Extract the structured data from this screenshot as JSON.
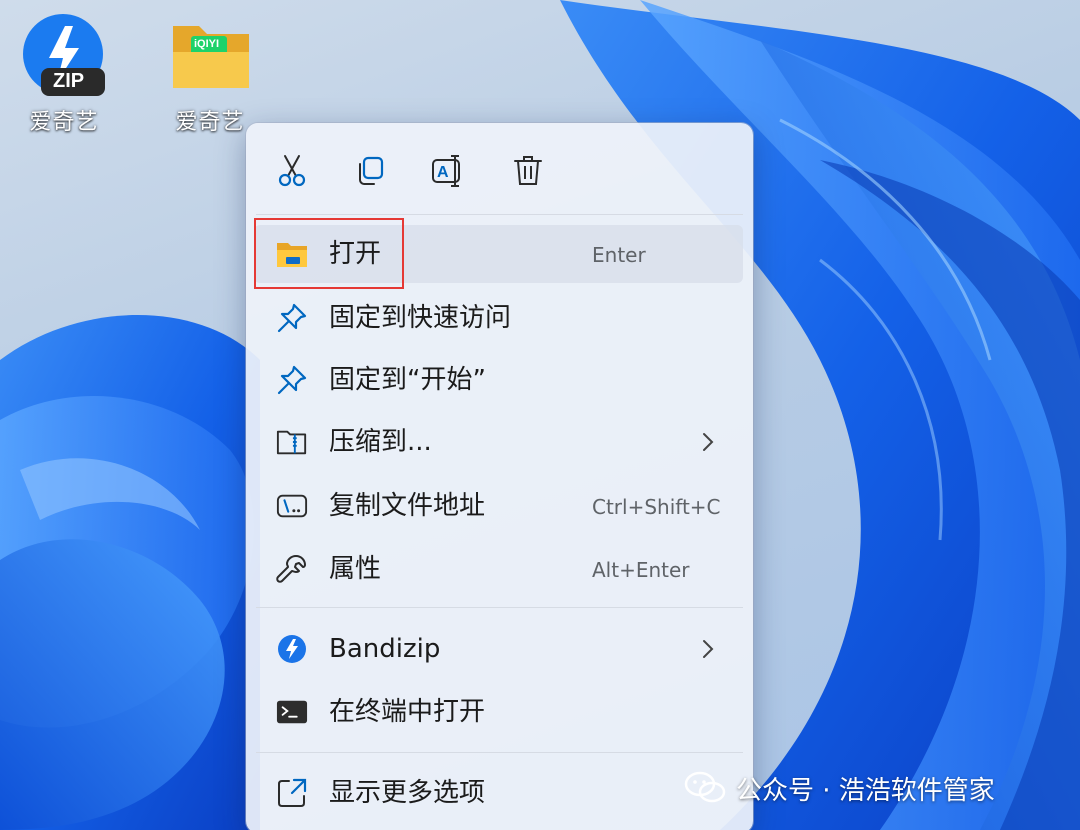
{
  "desktop": {
    "icons": [
      {
        "label": "爱奇艺",
        "icon": "bandizip-zip-icon",
        "badge_text": "ZIP"
      },
      {
        "label": "爱奇艺",
        "icon": "folder-icon",
        "badge_text": "iQIYI"
      }
    ]
  },
  "context_menu": {
    "toolbar": [
      {
        "action": "cut",
        "icon": "scissors-icon"
      },
      {
        "action": "copy",
        "icon": "copy-icon"
      },
      {
        "action": "rename",
        "icon": "rename-icon"
      },
      {
        "action": "delete",
        "icon": "trash-icon"
      }
    ],
    "items": [
      {
        "label": "打开",
        "shortcut": "Enter",
        "icon": "folder-open-icon"
      },
      {
        "label": "固定到快速访问",
        "shortcut": "",
        "icon": "pin-icon"
      },
      {
        "label": "固定到“开始”",
        "shortcut": "",
        "icon": "pin-icon"
      },
      {
        "label": "压缩到...",
        "shortcut": "",
        "icon": "zip-folder-icon",
        "submenu": true
      },
      {
        "label": "复制文件地址",
        "shortcut": "Ctrl+Shift+C",
        "icon": "path-icon"
      },
      {
        "label": "属性",
        "shortcut": "Alt+Enter",
        "icon": "wrench-icon"
      },
      {
        "label": "Bandizip",
        "shortcut": "",
        "icon": "bandizip-icon",
        "submenu": true
      },
      {
        "label": "在终端中打开",
        "shortcut": "",
        "icon": "terminal-icon"
      },
      {
        "label": "显示更多选项",
        "shortcut": "",
        "icon": "more-options-icon"
      }
    ]
  },
  "watermark": {
    "text": "公众号 · 浩浩软件管家",
    "icon": "wechat-icon"
  },
  "colors": {
    "accent": "#0067c0",
    "highlight_border": "#e53935",
    "menu_bg": "#eef2fa"
  }
}
